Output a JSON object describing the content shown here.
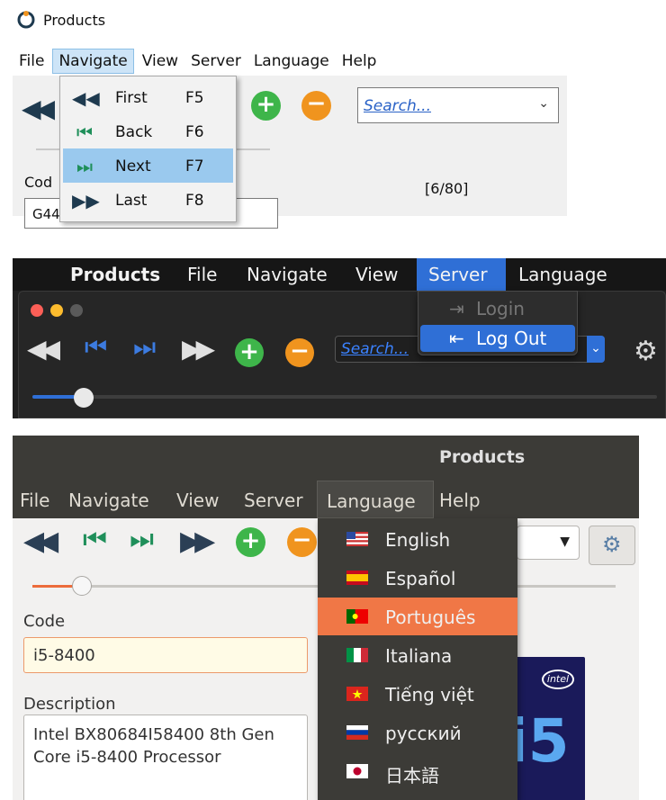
{
  "panel1": {
    "window_title": "Products",
    "menus": [
      "File",
      "Navigate",
      "View",
      "Server",
      "Language",
      "Help"
    ],
    "active_menu": "Navigate",
    "navigate_menu": [
      {
        "label": "First",
        "shortcut": "F5",
        "icon": "first-icon"
      },
      {
        "label": "Back",
        "shortcut": "F6",
        "icon": "back-icon"
      },
      {
        "label": "Next",
        "shortcut": "F7",
        "icon": "next-icon",
        "selected": true
      },
      {
        "label": "Last",
        "shortcut": "F8",
        "icon": "last-icon"
      }
    ],
    "search_placeholder": "Search...",
    "code_label": "Cod",
    "code_value": "G44",
    "record_counter": "[6/80]"
  },
  "panel2": {
    "app_name": "Products",
    "menus": [
      "File",
      "Navigate",
      "View",
      "Server",
      "Language"
    ],
    "active_menu": "Server",
    "server_menu": [
      {
        "label": "Login",
        "icon": "login-icon",
        "disabled": true
      },
      {
        "label": "Log Out",
        "icon": "logout-icon",
        "selected": true
      }
    ],
    "search_placeholder": "Search...",
    "slider_position": 0.08
  },
  "panel3": {
    "window_title": "Products",
    "menus": [
      "File",
      "Navigate",
      "View",
      "Server",
      "Language",
      "Help"
    ],
    "active_menu": "Language",
    "language_menu": [
      {
        "label": "English",
        "flag": "us-flag"
      },
      {
        "label": "Español",
        "flag": "spain-flag"
      },
      {
        "label": "Português",
        "flag": "portugal-flag",
        "selected": true
      },
      {
        "label": "Italiana",
        "flag": "italy-flag"
      },
      {
        "label": "Tiếng việt",
        "flag": "vietnam-flag"
      },
      {
        "label": "русский",
        "flag": "russia-flag"
      },
      {
        "label": "日本語",
        "flag": "japan-flag"
      }
    ],
    "code_label": "Code",
    "code_value": "i5-8400",
    "description_label": "Description",
    "description_value": "Intel BX80684I58400 8th Gen Core i5-8400 Processor",
    "image_text": "i5",
    "image_brand": "intel",
    "slider_position": 0.1
  },
  "colors": {
    "add": "#3eb54a",
    "remove": "#f0941e",
    "mac_accent": "#2f6fd6",
    "ubuntu_accent": "#f07746",
    "win_highlight": "#9ac9ee"
  }
}
